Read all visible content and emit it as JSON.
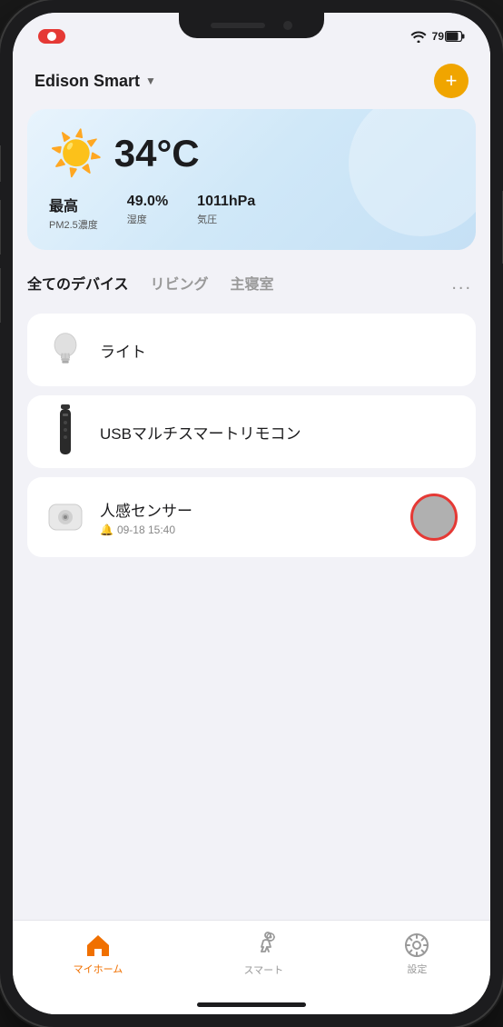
{
  "status_bar": {
    "record_indicator": "●",
    "wifi": "📶",
    "battery": "79"
  },
  "header": {
    "title": "Edison Smart",
    "dropdown_arrow": "▼",
    "add_button": "+"
  },
  "weather": {
    "icon": "☀️",
    "temperature": "34°C",
    "stats": [
      {
        "value": "最高",
        "label": "PM2.5濃度"
      },
      {
        "value": "49.0%",
        "label": "湿度"
      },
      {
        "value": "1011hPa",
        "label": "気圧"
      }
    ]
  },
  "tabs": [
    {
      "label": "全てのデバイス",
      "active": true
    },
    {
      "label": "リビング",
      "active": false
    },
    {
      "label": "主寝室",
      "active": false
    }
  ],
  "tabs_more": "...",
  "devices": [
    {
      "id": "light",
      "name": "ライト",
      "sub": "",
      "has_status_btn": false
    },
    {
      "id": "usb-remote",
      "name": "USBマルチスマートリモコン",
      "sub": "",
      "has_status_btn": false
    },
    {
      "id": "motion-sensor",
      "name": "人感センサー",
      "sub": "🔔 09-18 15:40",
      "has_status_btn": true
    }
  ],
  "bottom_nav": [
    {
      "id": "home",
      "label": "マイホーム",
      "active": true
    },
    {
      "id": "smart",
      "label": "スマート",
      "active": false
    },
    {
      "id": "settings",
      "label": "設定",
      "active": false
    }
  ]
}
